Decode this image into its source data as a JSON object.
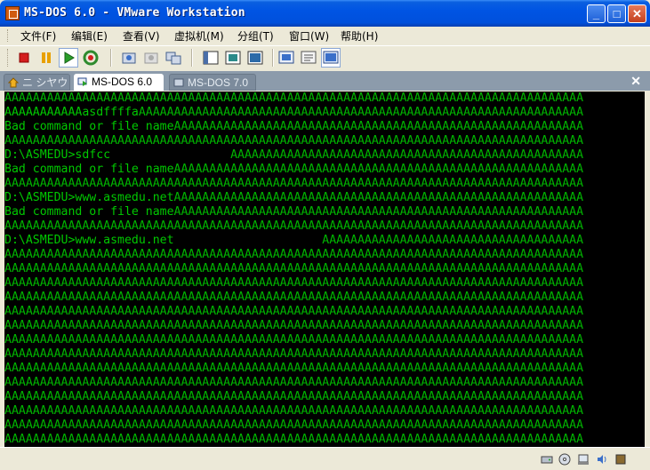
{
  "window": {
    "title": "MS-DOS 6.0 - VMware Workstation",
    "minimize_glyph": "_",
    "maximize_glyph": "□",
    "close_glyph": "✕"
  },
  "menu": {
    "items": [
      "文件(F)",
      "编辑(E)",
      "查看(V)",
      "虚拟机(M)",
      "分组(T)",
      "窗口(W)",
      "帮助(H)"
    ]
  },
  "toolbar": {
    "buttons": [
      {
        "name": "power-off-icon",
        "color": "#D41E1E"
      },
      {
        "name": "pause-icon",
        "color": "#E8A000"
      },
      {
        "name": "play-icon",
        "color": "#2A9E2A"
      },
      {
        "name": "reset-icon",
        "color": "#2E8B2E"
      },
      {
        "name": "snapshot-take-icon"
      },
      {
        "name": "snapshot-revert-icon"
      },
      {
        "name": "snapshot-manager-icon"
      },
      {
        "name": "sidebar-toggle-icon"
      },
      {
        "name": "quick-switch-icon"
      },
      {
        "name": "full-screen-icon"
      },
      {
        "name": "console-view-icon"
      },
      {
        "name": "summary-view-icon"
      },
      {
        "name": "unity-view-icon"
      }
    ]
  },
  "tabs": {
    "home_label": "ニ シヤウ",
    "active_label": "MS-DOS 6.0",
    "inactive_label": "MS-DOS 7.0",
    "close_glyph": "✕"
  },
  "console": {
    "fill_char": "A",
    "line_length": 82,
    "lines": [
      {
        "text": "",
        "fill": true
      },
      {
        "text": "AAAAAAAAAAAasdffffa",
        "fill": true
      },
      {
        "text": "Bad command or file name",
        "fill": true
      },
      {
        "text": "",
        "fill": true
      },
      {
        "text": "D:\\ASMEDU>sdfcc",
        "fill_from": 32
      },
      {
        "text": "Bad command or file name",
        "fill": true
      },
      {
        "text": "",
        "fill": true
      },
      {
        "text": "D:\\ASMEDU>www.asmedu.net",
        "fill": true
      },
      {
        "text": "Bad command or file name",
        "fill": true
      },
      {
        "text": "",
        "fill": true
      },
      {
        "text": "D:\\ASMEDU>www.asmedu.net",
        "fill_from": 45
      },
      {
        "text": "",
        "fill": true
      },
      {
        "text": "",
        "fill": true
      },
      {
        "text": "",
        "fill": true
      },
      {
        "text": "",
        "fill": true
      },
      {
        "text": "",
        "fill": true
      },
      {
        "text": "",
        "fill": true
      },
      {
        "text": "",
        "fill": true
      },
      {
        "text": "",
        "fill": true
      },
      {
        "text": "",
        "fill": true
      },
      {
        "text": "",
        "fill": true
      },
      {
        "text": "",
        "fill": true
      },
      {
        "text": "",
        "fill": true
      },
      {
        "text": "",
        "fill": true
      },
      {
        "text": "",
        "fill": true
      }
    ]
  },
  "statusbar": {
    "icons": [
      "hard-disk-icon",
      "cdrom-icon",
      "network-icon",
      "sound-icon",
      "vmware-tools-icon"
    ]
  },
  "colors": {
    "titlebar": "#0054E3",
    "console_bg": "#000000",
    "console_text": "#00C800"
  }
}
